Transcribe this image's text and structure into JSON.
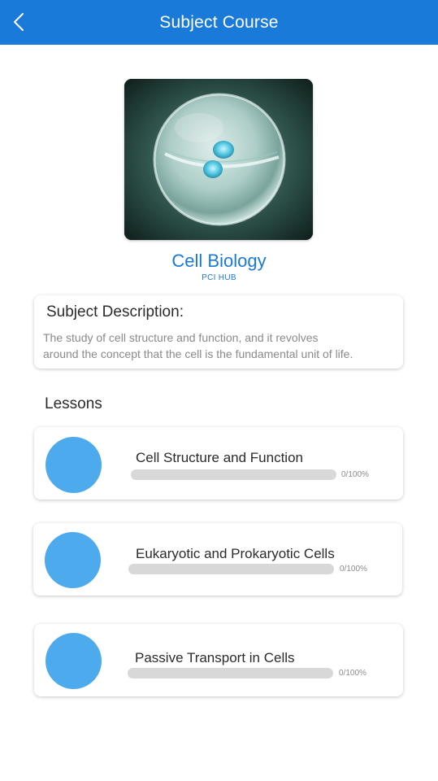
{
  "header": {
    "title": "Subject Course",
    "back_icon": "chevron-left-icon"
  },
  "course": {
    "name": "Cell Biology",
    "organization": "PCI HUB",
    "image": "cell-division-image"
  },
  "description": {
    "title": "Subject Description:",
    "text_line1": "The study of cell structure and function, and it revolves",
    "text_line2": "around the concept that the cell is the fundamental unit of life."
  },
  "lessons_label": "Lessons",
  "lessons": [
    {
      "title": "Cell Structure and Function",
      "progress": 0,
      "progress_label": "0/100%"
    },
    {
      "title": "Eukaryotic and Prokaryotic Cells",
      "progress": 0,
      "progress_label": "0/100%"
    },
    {
      "title": "Passive Transport in Cells",
      "progress": 0,
      "progress_label": "0/100%"
    }
  ],
  "colors": {
    "primary": "#1a7ad9",
    "accent": "#4daaed",
    "track": "#d8d8d8"
  }
}
